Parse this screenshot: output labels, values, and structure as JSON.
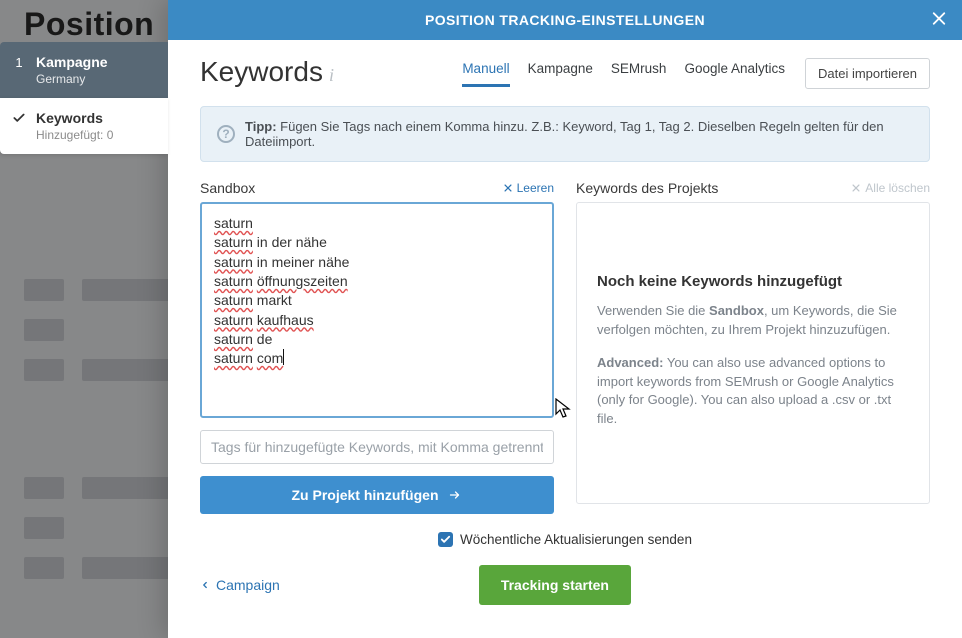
{
  "background": {
    "page_title": "Position"
  },
  "steps": [
    {
      "title": "Kampagne",
      "sub": "Germany",
      "done": true
    },
    {
      "title": "Keywords",
      "sub": "Hinzugefügt: 0",
      "done": false,
      "active": true
    }
  ],
  "modal": {
    "header": "POSITION TRACKING-EINSTELLUNGEN",
    "title": "Keywords",
    "tabs": [
      "Manuell",
      "Kampagne",
      "SEMrush",
      "Google Analytics"
    ],
    "import_btn": "Datei importieren",
    "tip_label": "Tipp:",
    "tip_text": "Fügen Sie Tags nach einem Komma hinzu. Z.B.: Keyword, Tag 1, Tag 2. Dieselben Regeln gelten für den Dateiimport."
  },
  "sandbox": {
    "heading": "Sandbox",
    "clear_label": "Leeren",
    "keywords": [
      "saturn",
      "saturn in der nähe",
      "saturn in meiner nähe",
      "saturn öffnungszeiten",
      "saturn markt",
      "saturn kaufhaus",
      "saturn de",
      "saturn com"
    ],
    "tags_placeholder": "Tags für hinzugefügte Keywords, mit Komma getrennt",
    "add_btn": "Zu Projekt hinzufügen"
  },
  "project": {
    "heading": "Keywords des Projekts",
    "delete_all": "Alle löschen",
    "empty_title": "Noch keine Keywords hinzugefügt",
    "empty_p1_a": "Verwenden Sie die ",
    "empty_p1_b": "Sandbox",
    "empty_p1_c": ", um Keywords, die Sie verfolgen möchten, zu Ihrem Projekt hinzuzufügen.",
    "empty_p2_a": "Advanced:",
    "empty_p2_b": " You can also use advanced options to import keywords from SEMrush or Google Analytics (only for Google). You can also upload a .csv or .txt file."
  },
  "footer": {
    "weekly_label": "Wöchentliche Aktualisierungen senden",
    "back_label": "Campaign",
    "start_btn": "Tracking starten"
  }
}
